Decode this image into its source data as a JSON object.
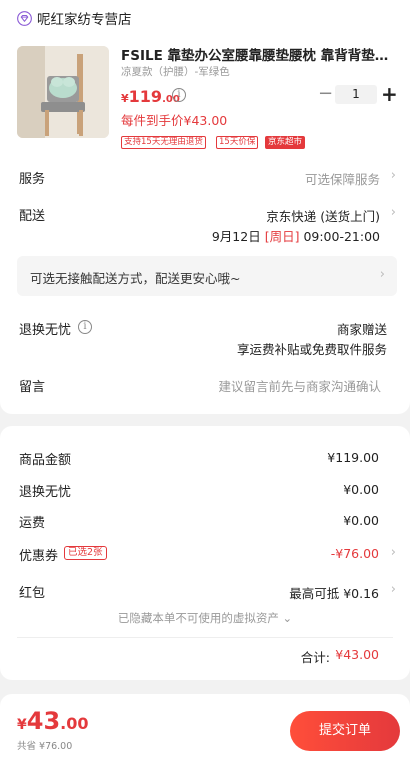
{
  "store": {
    "name": "呢红家纺专营店",
    "icon": "store-gem-icon"
  },
  "product": {
    "title": "FSILE 靠垫办公室腰靠腰垫腰枕 靠背背垫腰...",
    "spec": "凉夏款（护腰）-军绿色",
    "price_currency": "¥",
    "price_int": "119",
    "price_dec": ".00",
    "hand_price": "每件到手价¥43.00",
    "tags": [
      "支持15天无理由退货",
      "15天价保",
      "京东超市"
    ],
    "quantity": "1",
    "minus": "−",
    "plus": "+"
  },
  "service": {
    "label": "服务",
    "value": "可选保障服务"
  },
  "delivery": {
    "label": "配送",
    "method": "京东快递 (送货上门)",
    "date": "9月12日",
    "weekday": "[周日]",
    "time": "09:00-21:00"
  },
  "notice": {
    "text": "可选无接触配送方式，配送更安心哦~"
  },
  "return_worry": {
    "label": "退换无忧",
    "value": "商家赠送",
    "desc": "享运费补贴或免费取件服务"
  },
  "message": {
    "label": "留言",
    "placeholder": "建议留言前先与商家沟通确认"
  },
  "summary": {
    "goods_label": "商品金额",
    "goods_value": "¥119.00",
    "return_label": "退换无忧",
    "return_value": "¥0.00",
    "shipping_label": "运费",
    "shipping_value": "¥0.00",
    "coupon_label": "优惠券",
    "coupon_badge": "已选2张",
    "coupon_value": "-¥76.00",
    "redpacket_label": "红包",
    "redpacket_value": "最高可抵 ¥0.16",
    "hidden_note": "已隐藏本单不可使用的虚拟资产 ⌄",
    "total_label": "合计:",
    "total_value": "¥43.00"
  },
  "footer": {
    "currency": "¥",
    "total_int": "43",
    "total_dec": ".00",
    "saved": "共省 ¥76.00",
    "submit": "提交订单"
  },
  "colors": {
    "accent": "#e4393c",
    "background": "#f2f2f2"
  }
}
